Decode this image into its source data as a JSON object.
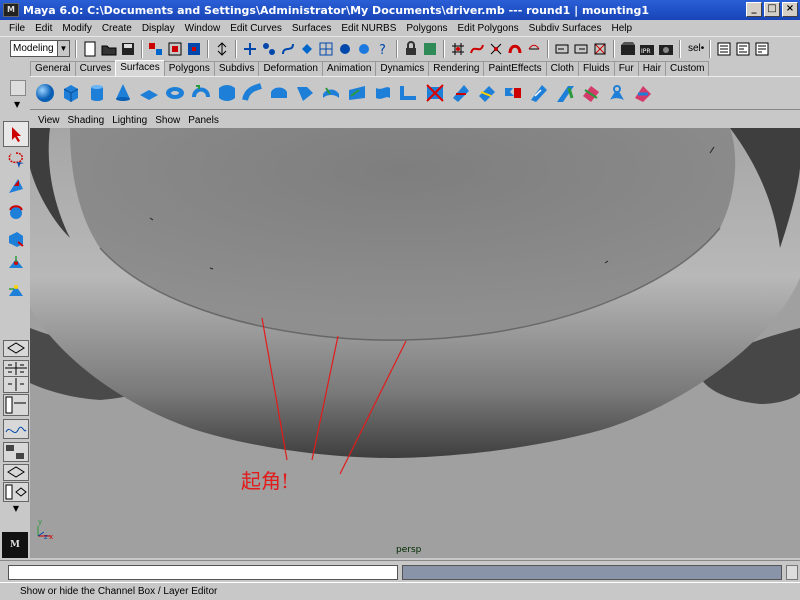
{
  "window": {
    "title": "Maya 6.0: C:\\Documents and Settings\\Administrator\\My Documents\\driver.mb  ---  round1 | mounting1",
    "app_badge": "M"
  },
  "menu": [
    "File",
    "Edit",
    "Modify",
    "Create",
    "Display",
    "Window",
    "Edit Curves",
    "Surfaces",
    "Edit NURBS",
    "Polygons",
    "Edit Polygons",
    "Subdiv Surfaces",
    "Help"
  ],
  "statusline": {
    "mode": "Modeling",
    "sel_label": "sel•"
  },
  "shelf_tabs": [
    "General",
    "Curves",
    "Surfaces",
    "Polygons",
    "Subdivs",
    "Deformation",
    "Animation",
    "Dynamics",
    "Rendering",
    "PaintEffects",
    "Cloth",
    "Fluids",
    "Fur",
    "Hair",
    "Custom"
  ],
  "active_shelf_tab": "Surfaces",
  "panel_menu": [
    "View",
    "Shading",
    "Lighting",
    "Show",
    "Panels"
  ],
  "viewport": {
    "camera": "persp",
    "annotation": "起角!",
    "annotation_color": "#e21b1b"
  },
  "help_line": "Show or hide the Channel Box / Layer Editor",
  "maya_logo": "M",
  "colors": {
    "title_bar": "#1f50c8",
    "ui_gray": "#c8c8c8",
    "viewport_bg": "#a0a0a0",
    "command_result_bg": "#8a94a8"
  }
}
